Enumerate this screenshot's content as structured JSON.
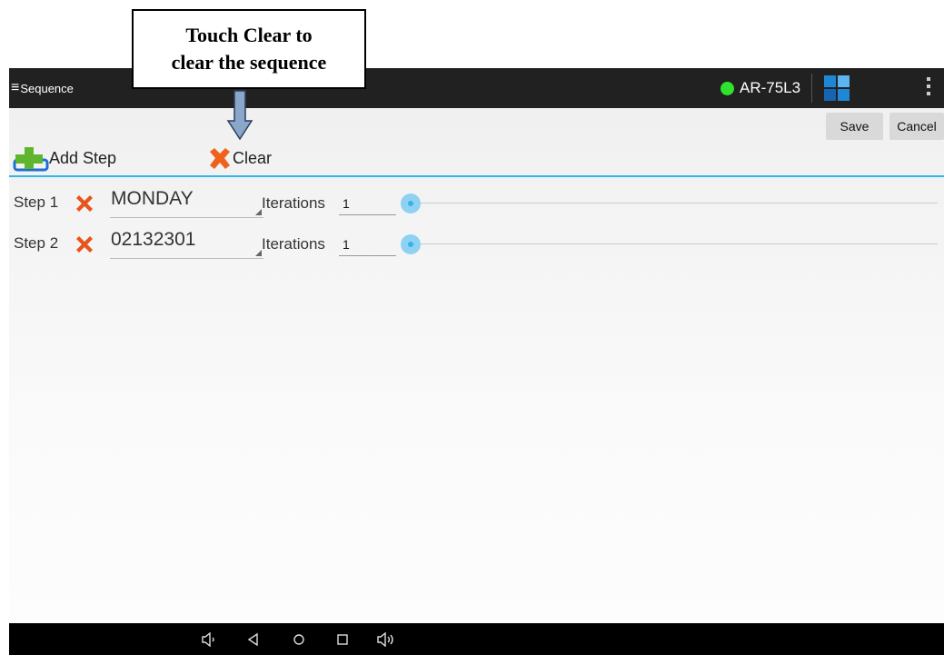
{
  "annotation": {
    "text": "Touch Clear to\nclear the sequence"
  },
  "appbar": {
    "title": "Sequence",
    "device_name": "AR-75L3",
    "status_color": "#2ee22e"
  },
  "actions": {
    "save_label": "Save",
    "cancel_label": "Cancel"
  },
  "toolbar": {
    "add_step_label": "Add Step",
    "clear_label": "Clear"
  },
  "steps": [
    {
      "label": "Step 1",
      "name": "MONDAY",
      "iterations_label": "Iterations",
      "iterations": "1"
    },
    {
      "label": "Step 2",
      "name": "02132301",
      "iterations_label": "Iterations",
      "iterations": "1"
    }
  ],
  "navbar": {
    "icons": [
      "volume-down-icon",
      "back-icon",
      "home-icon",
      "recents-icon",
      "volume-up-icon"
    ]
  },
  "colors": {
    "accent": "#33b5e5",
    "appbar": "#212121",
    "delete": "#e8541e"
  }
}
